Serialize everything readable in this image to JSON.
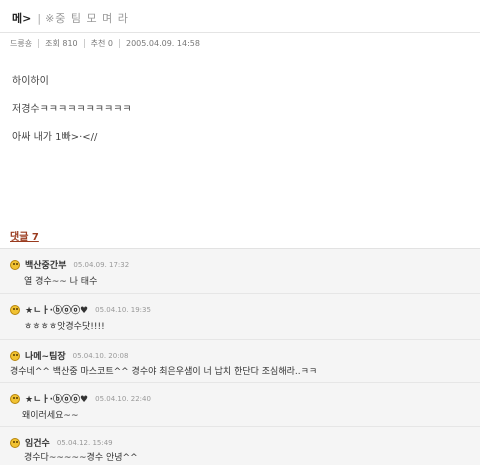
{
  "post": {
    "tag": "메>",
    "separator": "|",
    "title_rest": "※중 팀 모 며 라",
    "meta": {
      "author": "드릉숑",
      "views_label": "조회 810",
      "recommend_label": "추천 0",
      "datetime": "2005.04.09. 14:58"
    },
    "body_lines": [
      "하이하이",
      "저경수ㅋㅋㅋㅋㅋㅋㅋㅋㅋㅋ",
      "아싸 내가 1빠>·<//"
    ]
  },
  "comments_section": {
    "count_label": "댓글 7",
    "items": [
      {
        "author": "백산중간부",
        "date": "05.04.09. 17:32",
        "text": "열 경수~~ 나 태수"
      },
      {
        "author": "★ㄴㅏ·ⓑⓞⓞ♥",
        "date": "05.04.10. 19:35",
        "text": "ㅎㅎㅎㅎ앗경수닷!!!!"
      },
      {
        "author": "나메~팀장",
        "date": "05.04.10. 20:08",
        "text": "경수네^^ 백산중 마스코트^^ 경수야 최은우샘이 너 납치 한단다 조심해라..ㅋㅋ"
      },
      {
        "author": "★ㄴㅏ·ⓑⓞⓞ♥",
        "date": "05.04.10. 22:40",
        "text": "왜이러세요~~"
      },
      {
        "author": "임건수",
        "date": "05.04.12. 15:49",
        "text": "경수다~~~~~경수 안녕^^"
      }
    ]
  }
}
